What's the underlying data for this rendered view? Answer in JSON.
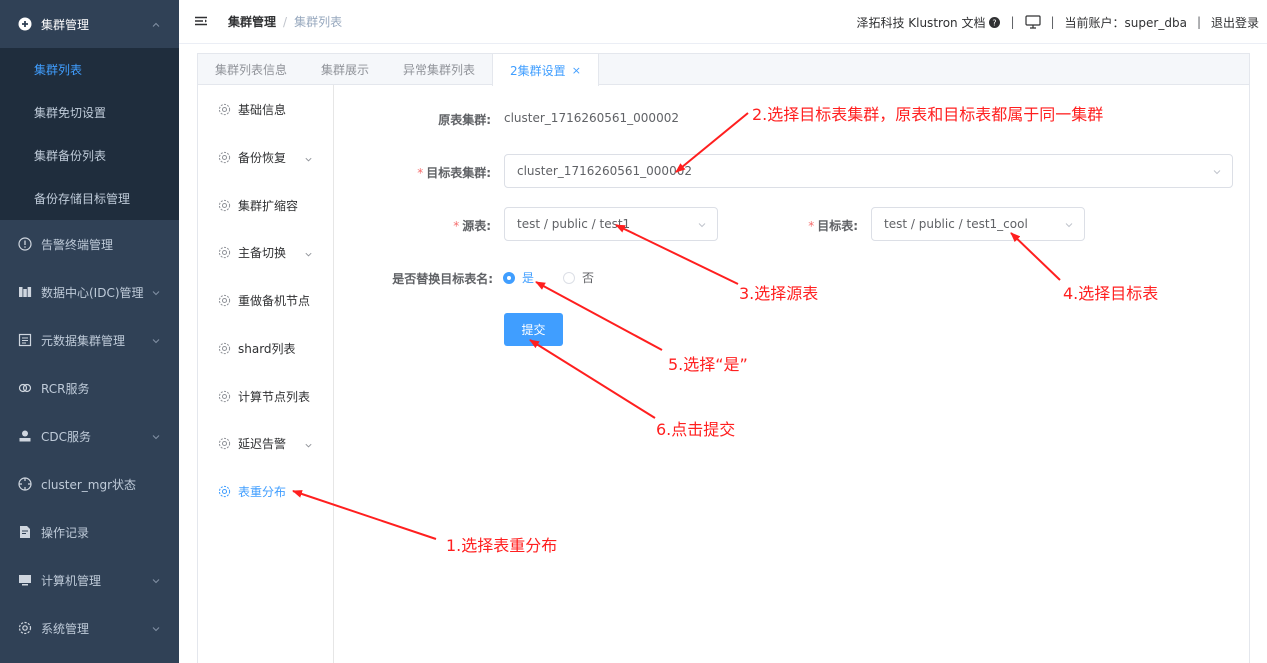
{
  "sidebar": {
    "items": [
      {
        "label": "集群管理",
        "icon": "plus-circle-icon",
        "expanded": true,
        "children": [
          {
            "label": "集群列表",
            "active": true
          },
          {
            "label": "集群免切设置"
          },
          {
            "label": "集群备份列表"
          },
          {
            "label": "备份存储目标管理"
          }
        ]
      },
      {
        "label": "告警终端管理",
        "icon": "alert-circle-icon"
      },
      {
        "label": "数据中心(IDC)管理",
        "icon": "datacenter-icon"
      },
      {
        "label": "元数据集群管理",
        "icon": "metadata-icon"
      },
      {
        "label": "RCR服务",
        "icon": "link-icon"
      },
      {
        "label": "CDC服务",
        "icon": "user-icon"
      },
      {
        "label": "cluster_mgr状态",
        "icon": "compass-icon"
      },
      {
        "label": "操作记录",
        "icon": "record-icon"
      },
      {
        "label": "计算机管理",
        "icon": "computer-icon"
      },
      {
        "label": "系统管理",
        "icon": "gear-icon"
      }
    ]
  },
  "header": {
    "breadcrumb_root": "集群管理",
    "breadcrumb_sep": "/",
    "breadcrumb_current": "集群列表",
    "docs_label": "泽拓科技 Klustron 文档",
    "pipe": "|",
    "account_label": "当前账户：super_dba",
    "logout_label": "退出登录"
  },
  "tabs": [
    {
      "label": "集群列表信息"
    },
    {
      "label": "集群展示"
    },
    {
      "label": "异常集群列表"
    },
    {
      "label": "2集群设置",
      "active": true,
      "close": "×"
    }
  ],
  "submenu": [
    {
      "label": "基础信息"
    },
    {
      "label": "备份恢复",
      "has_children": true
    },
    {
      "label": "集群扩缩容"
    },
    {
      "label": "主备切换",
      "has_children": true
    },
    {
      "label": "重做备机节点"
    },
    {
      "label": "shard列表"
    },
    {
      "label": "计算节点列表"
    },
    {
      "label": "延迟告警",
      "has_children": true
    },
    {
      "label": "表重分布",
      "active": true
    }
  ],
  "form": {
    "source_cluster_label": "原表集群:",
    "source_cluster_value": "cluster_1716260561_000002",
    "target_cluster_label": "目标表集群:",
    "target_cluster_value": "cluster_1716260561_000002",
    "required_mark": "*",
    "source_table_label": "源表:",
    "source_table_value": "test / public / test1",
    "target_table_label": "目标表:",
    "target_table_value": "test / public / test1_cool",
    "replace_name_label": "是否替换目标表名:",
    "option_yes": "是",
    "option_no": "否",
    "selected_option": "是",
    "submit_label": "提交"
  },
  "annotations": {
    "step1": "1.选择表重分布",
    "step2": "2.选择目标表集群，原表和目标表都属于同一集群",
    "step3": "3.选择源表",
    "step4": "4.选择目标表",
    "step5": "5.选择“是”",
    "step6": "6.点击提交",
    "color": "#ff1f1f"
  },
  "colors": {
    "sidebar_bg": "#304156",
    "submenu_bg": "#1f2d3d",
    "accent": "#409eff",
    "required": "#f56c6c"
  }
}
